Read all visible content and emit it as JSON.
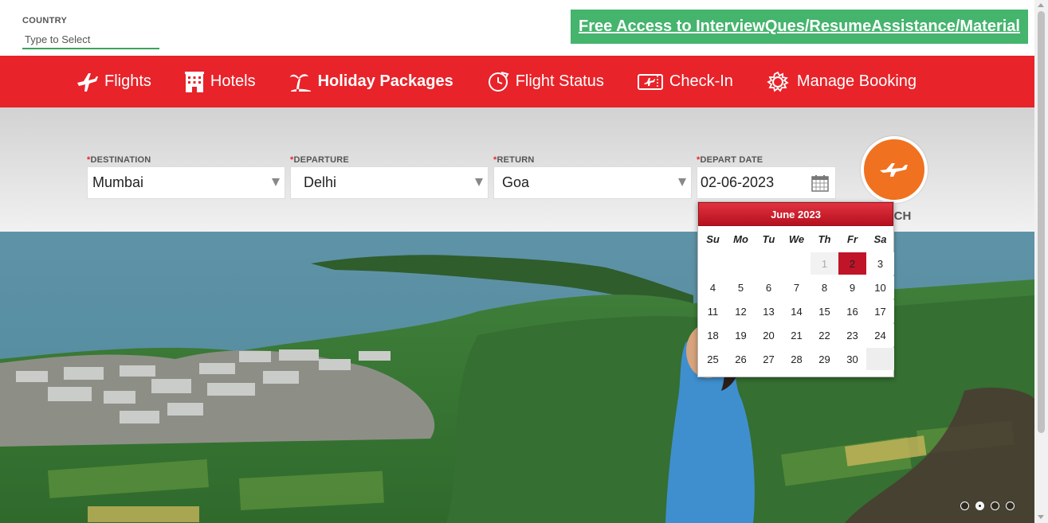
{
  "country": {
    "label": "COUNTRY",
    "placeholder": "Type to Select"
  },
  "promo": {
    "text": "Free Access to InterviewQues/ResumeAssistance/Material"
  },
  "nav": {
    "flights": "Flights",
    "hotels": "Hotels",
    "holiday": "Holiday Packages",
    "flight_status": "Flight Status",
    "checkin": "Check-In",
    "manage": "Manage Booking"
  },
  "form": {
    "destination_label": "DESTINATION",
    "destination_value": "Mumbai",
    "departure_label": "DEPARTURE",
    "departure_value": "Delhi",
    "return_label": "RETURN",
    "return_value": "Goa",
    "depart_date_label": "DEPART DATE",
    "depart_date_value": "02-06-2023",
    "required_mark": "*",
    "search_label": "ARCH"
  },
  "calendar": {
    "month": "June 2023",
    "days_of_week": [
      "Su",
      "Mo",
      "Tu",
      "We",
      "Th",
      "Fr",
      "Sa"
    ],
    "selected_day": 2
  },
  "carousel": {
    "slides": 4,
    "active": 1
  },
  "colors": {
    "brand_red": "#e8232a",
    "promo_green": "#45b46d",
    "search_orange": "#f0711f"
  }
}
